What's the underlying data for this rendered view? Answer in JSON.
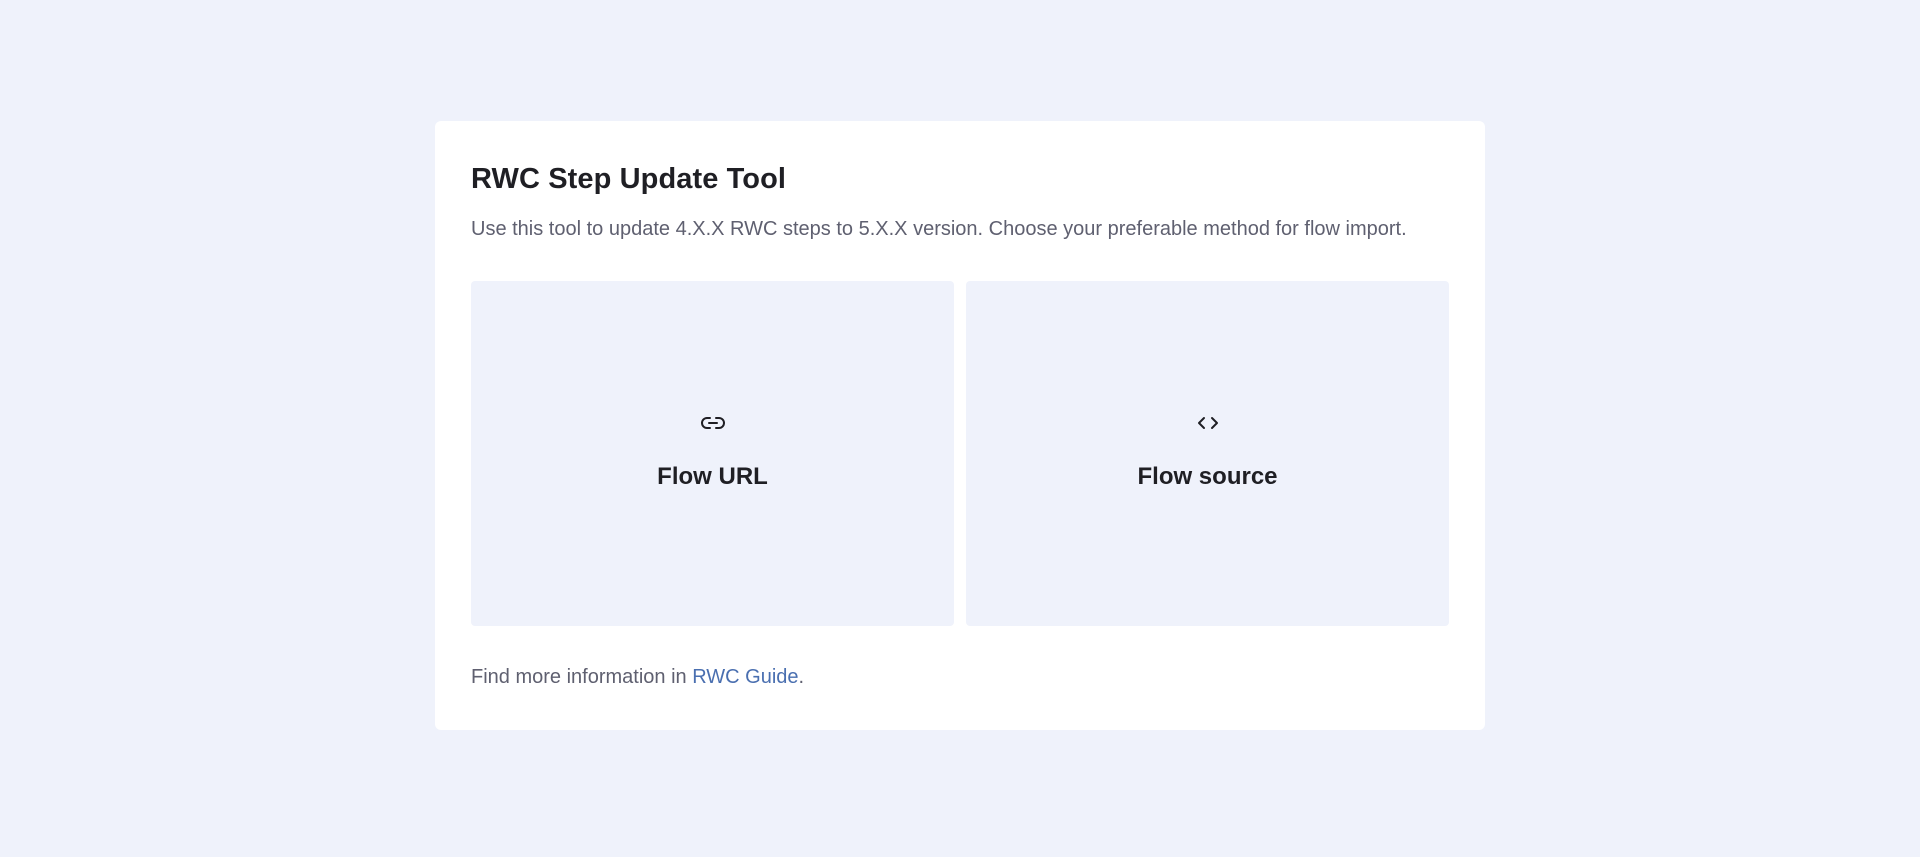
{
  "header": {
    "title": "RWC Step Update Tool",
    "subtitle": "Use this tool to update 4.X.X RWC steps to 5.X.X version. Choose your preferable method for flow import."
  },
  "options": [
    {
      "icon": "link-icon",
      "label": "Flow URL"
    },
    {
      "icon": "code-icon",
      "label": "Flow source"
    }
  ],
  "footer": {
    "prefix": "Find more information in ",
    "link_text": "RWC Guide",
    "suffix": "."
  },
  "colors": {
    "background": "#eff2fb",
    "card": "#ffffff",
    "link": "#4a6fb0",
    "text": "#1f1f24",
    "muted_text": "#5f6070"
  }
}
